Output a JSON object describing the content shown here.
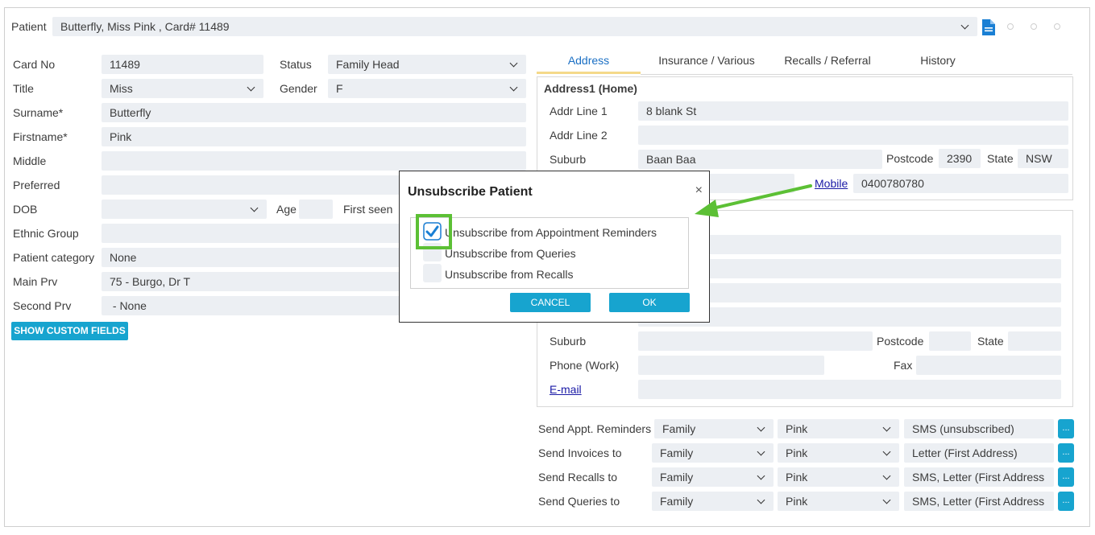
{
  "patient_bar": {
    "label": "Patient",
    "value": "Butterfly, Miss Pink , Card# 11489"
  },
  "left": {
    "card_no_label": "Card No",
    "card_no": "11489",
    "status_label": "Status",
    "status": "Family Head",
    "title_label": "Title",
    "title": "Miss",
    "gender_label": "Gender",
    "gender": "F",
    "surname_label": "Surname*",
    "surname": "Butterfly",
    "firstname_label": "Firstname*",
    "firstname": "Pink",
    "middle_label": "Middle",
    "middle": "",
    "preferred_label": "Preferred",
    "preferred": "",
    "dob_label": "DOB",
    "dob": "",
    "age_label": "Age",
    "age": "",
    "first_seen_label": "First seen",
    "ethnic_label": "Ethnic Group",
    "ethnic": "",
    "category_label": "Patient category",
    "category": "None",
    "main_prv_label": "Main Prv",
    "main_prv": "75 - Burgo, Dr T",
    "second_prv_label": "Second Prv",
    "second_prv": " - None",
    "custom_fields_button": "SHOW CUSTOM FIELDS"
  },
  "tabs": [
    "Address",
    "Insurance / Various",
    "Recalls / Referral",
    "History"
  ],
  "address1": {
    "heading": "Address1 (Home)",
    "addr1_label": "Addr Line 1",
    "addr1": "8 blank St",
    "addr2_label": "Addr Line 2",
    "addr2": "",
    "suburb_label": "Suburb",
    "suburb": "Baan Baa",
    "postcode_label": "Postcode",
    "postcode": "2390",
    "state_label": "State",
    "state": "NSW",
    "mobile_label": "Mobile",
    "mobile": "0400780780"
  },
  "address2": {
    "suburb_label": "Suburb",
    "postcode_label": "Postcode",
    "state_label": "State",
    "phone_work_label": "Phone (Work)",
    "fax_label": "Fax",
    "email_label": "E-mail"
  },
  "send": [
    {
      "label": "Send Appt. Reminders",
      "who": "Family",
      "person": "Pink",
      "method": "SMS (unsubscribed)"
    },
    {
      "label": "Send Invoices to",
      "who": "Family",
      "person": "Pink",
      "method": "Letter (First Address)"
    },
    {
      "label": "Send Recalls to",
      "who": "Family",
      "person": "Pink",
      "method": "SMS, Letter (First Address"
    },
    {
      "label": "Send Queries to",
      "who": "Family",
      "person": "Pink",
      "method": "SMS, Letter (First Address"
    }
  ],
  "more_button": "...",
  "modal": {
    "title": "Unsubscribe Patient",
    "close": "×",
    "options": [
      {
        "label": "Unsubscribe from Appointment Reminders",
        "checked": true
      },
      {
        "label": "Unsubscribe from Queries",
        "checked": false
      },
      {
        "label": "Unsubscribe from Recalls",
        "checked": false
      }
    ],
    "cancel": "CANCEL",
    "ok": "OK"
  },
  "colors": {
    "accent": "#17a4cf",
    "highlight": "#5cc035",
    "field": "#eceff3",
    "link": "#1a1aa6"
  }
}
